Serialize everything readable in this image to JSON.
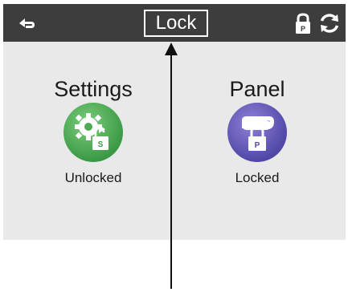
{
  "header": {
    "title": "Lock",
    "back_icon": "back-arrow-icon",
    "lock_icon": "lock-p-icon",
    "refresh_icon": "refresh-icon",
    "background": "#3d3d3d"
  },
  "tiles": [
    {
      "title": "Settings",
      "status": "Unlocked",
      "icon": "gear-unlock-icon",
      "color": "#3c9a45"
    },
    {
      "title": "Panel",
      "status": "Locked",
      "icon": "panel-lock-icon",
      "color": "#5248a8"
    }
  ],
  "content_background": "#e9e9e9"
}
